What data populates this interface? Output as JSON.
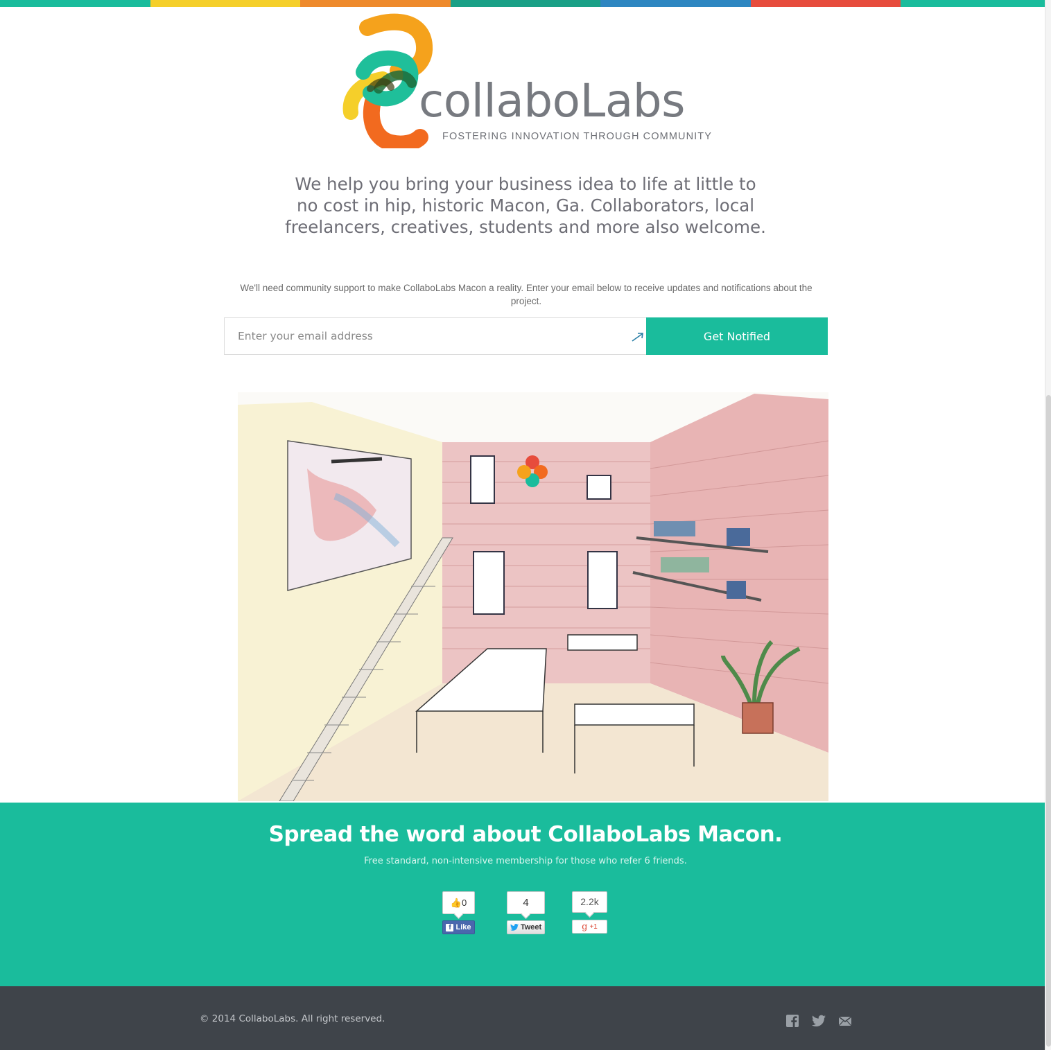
{
  "colors": {
    "accent": "#1abc9c",
    "footer_bg": "#3f444a",
    "topbar": [
      "#1abc9c",
      "#f5cf2a",
      "#ee8a2c",
      "#19a086",
      "#2e86c1",
      "#e74c3c",
      "#1abc9c"
    ]
  },
  "logo": {
    "wordmark": "collaboLabs",
    "tagline": "FOSTERING INNOVATION THROUGH COMMUNITY"
  },
  "hero": {
    "headline": "We help you bring your business idea to life at little to no cost in hip, historic Macon, Ga. Collaborators, local freelancers, creatives, students and more also welcome."
  },
  "signup": {
    "note": "We'll need community support to make CollaboLabs Macon a reality. Enter your email below to receive updates and notifications about the project.",
    "email_placeholder": "Enter your email address",
    "email_value": "",
    "button_label": "Get Notified"
  },
  "illustration": {
    "icon": "coworking-space-sketch"
  },
  "share": {
    "title": "Spread the word about CollaboLabs Macon.",
    "subtitle": "Free standard, non-intensive membership for those who refer 6 friends.",
    "facebook": {
      "count": "0",
      "label": "Like"
    },
    "twitter": {
      "count": "4",
      "label": "Tweet"
    },
    "google": {
      "count": "2.2k",
      "label": "+1",
      "glyph": "g"
    }
  },
  "footer": {
    "copyright": "© 2014 CollaboLabs. All right reserved.",
    "icons": [
      "facebook-icon",
      "twitter-icon",
      "mail-icon"
    ]
  }
}
